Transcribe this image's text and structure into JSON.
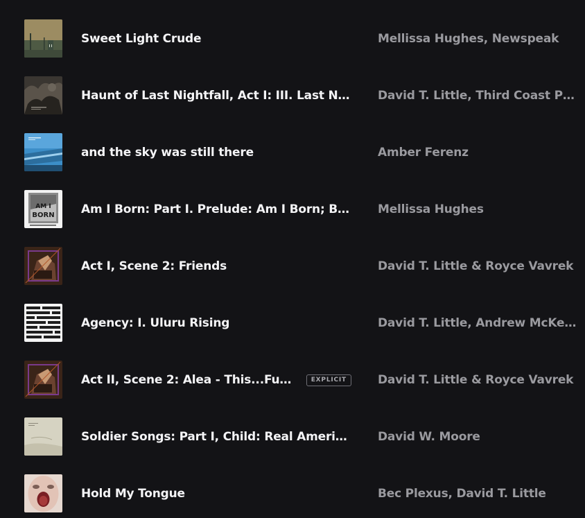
{
  "tracks": [
    {
      "title": "Sweet Light Crude",
      "artists": "Mellissa Hughes, Newspeak",
      "explicit": false,
      "art_icon": "album-art-sweet-light-crude"
    },
    {
      "title": "Haunt of Last Nightfall, Act I: III. Last Nightf...",
      "artists": "David T. Little, Third Coast Percu...",
      "explicit": false,
      "art_icon": "album-art-haunt-of-last-nightfall"
    },
    {
      "title": "and the sky was still there",
      "artists": "Amber Ferenz",
      "explicit": false,
      "art_icon": "album-art-and-the-sky"
    },
    {
      "title": "Am I Born: Part I. Prelude: Am I Born; Born ...",
      "artists": "Mellissa Hughes",
      "explicit": false,
      "art_icon": "album-art-am-i-born",
      "art_text": "AM I BORN"
    },
    {
      "title": "Act I, Scene 2: Friends",
      "artists": "David T. Little & Royce Vavrek",
      "explicit": false,
      "art_icon": "album-art-dog-days"
    },
    {
      "title": "Agency: I. Uluru Rising",
      "artists": "David T. Little, Andrew McKenna...",
      "explicit": false,
      "art_icon": "album-art-agency"
    },
    {
      "title": "Act II, Scene 2: Alea - This...Fucked",
      "artists": "David T. Little & Royce Vavrek",
      "explicit": true,
      "art_icon": "album-art-dog-days"
    },
    {
      "title": "Soldier Songs: Part I, Child: Real American ...",
      "artists": "David W. Moore",
      "explicit": false,
      "art_icon": "album-art-soldier-songs"
    },
    {
      "title": "Hold My Tongue",
      "artists": "Bec Plexus, David T. Little",
      "explicit": false,
      "art_icon": "album-art-hold-my-tongue"
    }
  ],
  "explicit_label": "EXPLICIT",
  "colors": {
    "background": "#131316",
    "title_text": "#f4f4f6",
    "artist_text": "#9a9a9f",
    "badge_border": "#6f6f76"
  }
}
